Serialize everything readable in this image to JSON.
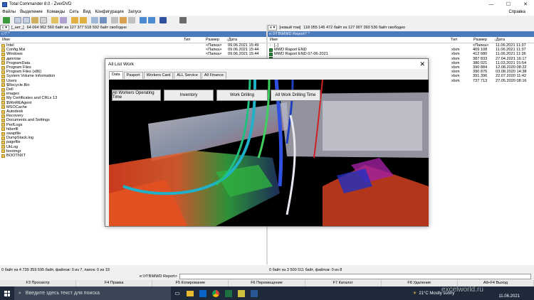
{
  "window": {
    "title": "Total Commander 8.0 - ZverDVD"
  },
  "menu": {
    "items": [
      "Файлы",
      "Выделение",
      "Команды",
      "Сеть",
      "Вид",
      "Конфигурация",
      "Запуск"
    ],
    "help": "Справка"
  },
  "left": {
    "drive": "c",
    "drive_label": "[_нет_]",
    "free_text": "64 064 962 560 байт из 127 377 518 592 байт свободно",
    "path": "c:\\*.*",
    "headers": {
      "name": "Имя",
      "type": "Тип",
      "size": "Размер",
      "date": "Дата"
    },
    "files": [
      {
        "name": "Intel",
        "size": "<Папка>",
        "date": "09.06.2021 15:49"
      },
      {
        "name": "Config.Msi",
        "size": "<Папка>",
        "date": "09.06.2021 15:44"
      },
      {
        "name": "Windows",
        "size": "<Папка>",
        "date": "09.06.2021 15:44"
      },
      {
        "name": "диплом",
        "size": "",
        "date": ""
      },
      {
        "name": "ProgramData",
        "size": "",
        "date": ""
      },
      {
        "name": "Program Files",
        "size": "",
        "date": ""
      },
      {
        "name": "Program Files (x86)",
        "size": "",
        "date": ""
      },
      {
        "name": "System Volume Information",
        "size": "",
        "date": ""
      },
      {
        "name": "Users",
        "size": "",
        "date": ""
      },
      {
        "name": "$Recycle.Bin",
        "size": "",
        "date": ""
      },
      {
        "name": "Dell",
        "size": "",
        "date": ""
      },
      {
        "name": "images",
        "size": "",
        "date": ""
      },
      {
        "name": "My Certificates and CRLs 13",
        "size": "",
        "date": ""
      },
      {
        "name": "$WinREAgent",
        "size": "",
        "date": ""
      },
      {
        "name": "MSOCache",
        "size": "",
        "date": ""
      },
      {
        "name": "Autodesk",
        "size": "",
        "date": ""
      },
      {
        "name": "Recovery",
        "size": "",
        "date": ""
      },
      {
        "name": "Documents and Settings",
        "size": "",
        "date": ""
      },
      {
        "name": "PerfLogs",
        "size": "",
        "date": ""
      },
      {
        "name": "hiberfil",
        "size": "",
        "date": ""
      },
      {
        "name": "swapfile",
        "size": "",
        "date": ""
      },
      {
        "name": "DumpStack.log",
        "size": "",
        "date": ""
      },
      {
        "name": "pagefile",
        "size": "",
        "date": ""
      },
      {
        "name": "UkLog",
        "size": "",
        "date": ""
      },
      {
        "name": "bootmgr",
        "size": "",
        "date": ""
      },
      {
        "name": "BOOTNXT",
        "size": "",
        "date": ""
      }
    ],
    "status": "0 байт из 4 739 359 595 байт, файлов: 0 из 7, папок: 0 из 19"
  },
  "right": {
    "drive": "e",
    "drive_label": "[новый том]",
    "free_text": "118 055 145 472 байт из 127 907 393 536 байт свободно",
    "path": "e:\\УГВ\\MWD Report\\*.*",
    "headers": {
      "name": "Имя",
      "type": "Тип",
      "size": "Размер",
      "date": "Дата"
    },
    "files": [
      {
        "name": "[..]",
        "ext": "",
        "size": "<Папка>",
        "date": "11.06.2021 11:37",
        "kind": "up"
      },
      {
        "name": "MWD Raport   END",
        "ext": "xlsm",
        "size": "409 108",
        "date": "11.06.2021 11:37",
        "kind": "xls"
      },
      {
        "name": "MWD Raport   END 07-06-2021",
        "ext": "xlsm",
        "size": "412 680",
        "date": "11.06.2021 11:36",
        "kind": "xls"
      },
      {
        "name": "",
        "ext": "xlsm",
        "size": "387 833",
        "date": "27.04.2021 16:17",
        "kind": "xls"
      },
      {
        "name": "",
        "ext": "xlsm",
        "size": "380 021",
        "date": "11.03.2021 15:54",
        "kind": "xls"
      },
      {
        "name": "",
        "ext": "xlsm",
        "size": "390 884",
        "date": "12.08.2020 08:22",
        "kind": "xls"
      },
      {
        "name": "",
        "ext": "xlsm",
        "size": "390 876",
        "date": "03.08.2020 14:38",
        "kind": "xls"
      },
      {
        "name": "",
        "ext": "xlsm",
        "size": "391 396",
        "date": "22.07.2020 11:42",
        "kind": "xls"
      },
      {
        "name": "",
        "ext": "xlsm",
        "size": "737 713",
        "date": "27.05.2020 08:16",
        "kind": "xls"
      }
    ],
    "status": "0 байт из 3 500 511 байт, файлов: 0 из 8"
  },
  "cmdline": {
    "path": "e:\\УГВ\\MWD Report>"
  },
  "fkeys": [
    "F3 Просмотр",
    "F4 Правка",
    "F5 Копирование",
    "F6 Перемещение",
    "F7 Каталог",
    "F8 Удаление",
    "Alt+F4 Выход"
  ],
  "dialog": {
    "title": "All List Work",
    "tabs": [
      "Data",
      "Pasport",
      "Workers Card",
      "ALL Service",
      "All Finance"
    ],
    "buttons": [
      "All Workers Operating Time",
      "Inventory",
      "Work Drilling",
      "All Work Drilling Time"
    ]
  },
  "taskbar": {
    "search_placeholder": "Введите здесь текст для поиска",
    "weather": "21°C  Mostly sunny",
    "lang": "ENG",
    "date": "11.06.2021"
  },
  "watermark": "excelworld.ru"
}
